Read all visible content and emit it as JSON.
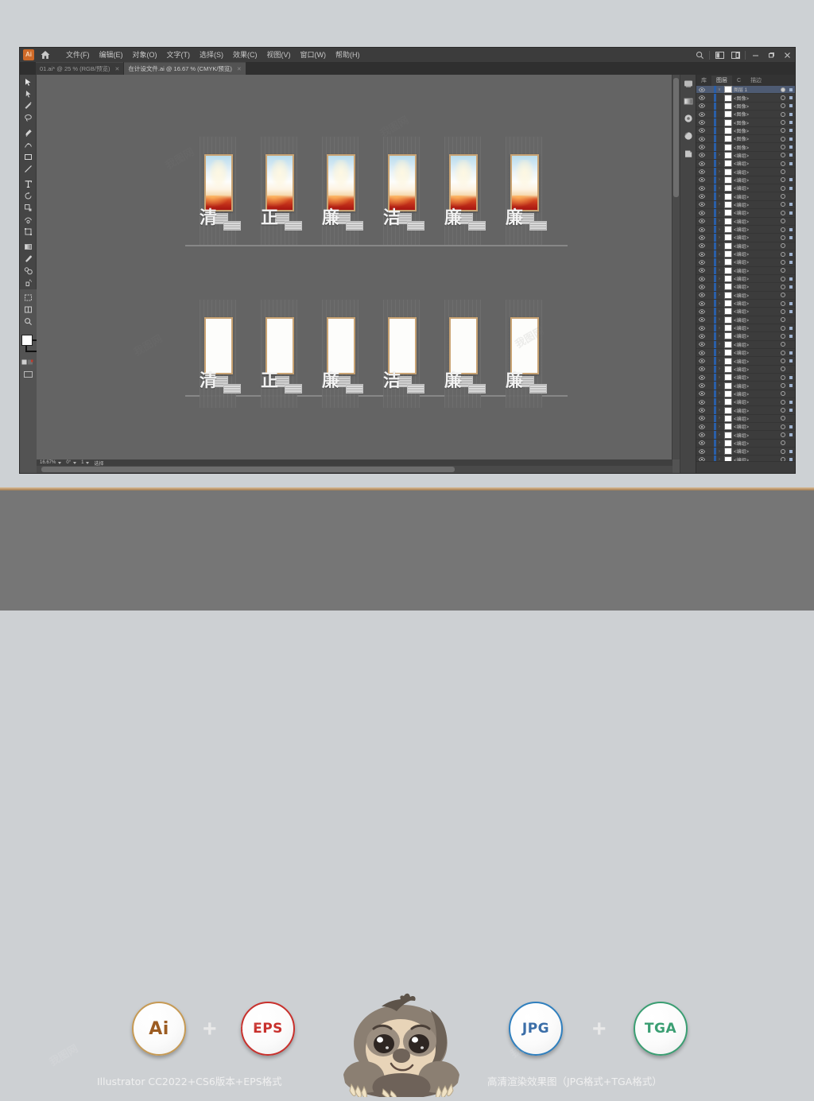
{
  "app": {
    "logo_text": "Ai",
    "menus": [
      {
        "label": "文件(F)",
        "name": "file"
      },
      {
        "label": "编辑(E)",
        "name": "edit"
      },
      {
        "label": "对象(O)",
        "name": "object"
      },
      {
        "label": "文字(T)",
        "name": "type"
      },
      {
        "label": "选择(S)",
        "name": "select"
      },
      {
        "label": "效果(C)",
        "name": "effect"
      },
      {
        "label": "视图(V)",
        "name": "view"
      },
      {
        "label": "窗口(W)",
        "name": "window"
      },
      {
        "label": "帮助(H)",
        "name": "help"
      }
    ],
    "window_controls": [
      "search-icon",
      "arrange-documents-icon",
      "workspace-icon",
      "minimize-icon",
      "restore-icon",
      "close-icon"
    ]
  },
  "tabs": [
    {
      "label": "01.ai* @ 25 % (RGB/预览)",
      "active": false
    },
    {
      "label": "在计设文件.ai @ 16.67 % (CMYK/预览)",
      "active": true
    }
  ],
  "toolbar": {
    "tools": [
      "selection-tool",
      "direct-selection-tool",
      "magic-wand-tool",
      "lasso-tool",
      "pen-tool",
      "curvature-tool",
      "rectangle-tool",
      "line-segment-tool",
      "type-tool",
      "rotate-tool",
      "scale-tool",
      "warp-tool",
      "free-transform-tool",
      "gradient-tool",
      "eyedropper-tool",
      "blend-tool",
      "symbol-sprayer-tool",
      "artboard-tool",
      "slice-tool",
      "zoom-tool"
    ],
    "fill_color": "#ffffff",
    "stroke_color": "#111111"
  },
  "canvas": {
    "row1": {
      "characters": [
        "清",
        "正",
        "廉",
        "洁",
        "廉",
        "廉"
      ],
      "poster_style": "sunrise-red-gradient"
    },
    "row2": {
      "characters": [
        "清",
        "正",
        "廉",
        "洁",
        "廉",
        "廉"
      ],
      "poster_style": "blank-white"
    }
  },
  "statusbar": {
    "zoom": "16.67%",
    "rotation": "0°",
    "artboard_nav": "1",
    "tool_label": "选择"
  },
  "panels": {
    "tabs": [
      {
        "label": "图层",
        "active": true
      },
      {
        "label": "库",
        "active": false
      },
      {
        "label": "C",
        "active": false
      },
      {
        "label": "描边",
        "active": false
      }
    ],
    "rail_icons": [
      "properties-icon",
      "gradient-icon",
      "color-icon",
      "swatches-icon",
      "artboards-icon"
    ],
    "root_layer": "图层 1",
    "image_rows": 7,
    "group_rows": 38,
    "image_label": "<图像>",
    "group_label": "<编组>"
  },
  "promo": {
    "badges_left": [
      {
        "text": "Ai",
        "color": "#9c5c22",
        "ring": "#c69a54"
      },
      {
        "text": "EPS",
        "color": "#c8302c",
        "ring": "#c8302c"
      }
    ],
    "badges_right": [
      {
        "text": "JPG",
        "color": "#3b6ea8",
        "ring": "#2f7fbe"
      },
      {
        "text": "TGA",
        "color": "#3a9e72",
        "ring": "#3a9e72"
      }
    ],
    "plus": "+",
    "caption_left": "Illustrator CC2022+CS6版本+EPS格式",
    "caption_right": "高清渲染效果图（JPG格式+TGA格式）",
    "mascot": "sloth-mascot"
  },
  "watermark": "我图网"
}
